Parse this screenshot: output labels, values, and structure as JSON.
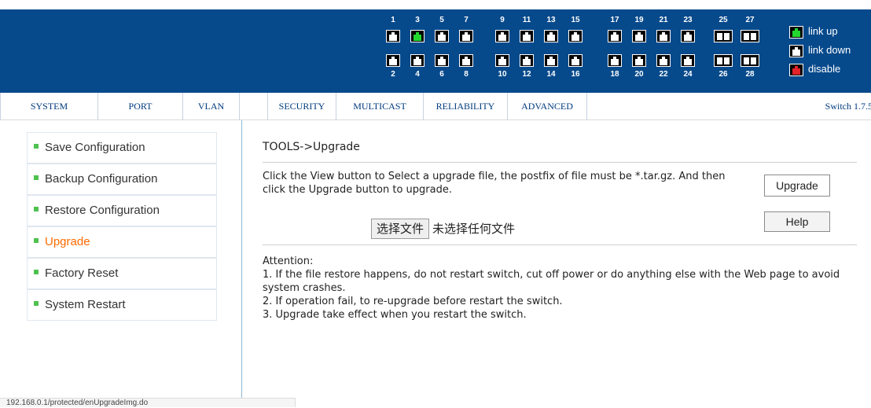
{
  "legend": {
    "link_up": "link up",
    "link_down": "link down",
    "disable": "disable",
    "colors": {
      "link_up": "#23d630",
      "link_down": "#ffffff",
      "disable": "#e2232a"
    }
  },
  "ports": {
    "top_numbers": [
      "1",
      "3",
      "5",
      "7",
      "9",
      "11",
      "13",
      "15",
      "17",
      "19",
      "21",
      "23",
      "25",
      "27"
    ],
    "bottom_numbers": [
      "2",
      "4",
      "6",
      "8",
      "10",
      "12",
      "14",
      "16",
      "18",
      "20",
      "22",
      "24",
      "26",
      "28"
    ],
    "link_up_ports": [
      "3"
    ]
  },
  "menu": {
    "tabs": [
      "SYSTEM",
      "PORT",
      "VLAN",
      "SECURITY",
      "MULTICAST",
      "RELIABILITY",
      "ADVANCED"
    ],
    "version": "Switch 1.7.5"
  },
  "sidebar": {
    "items": [
      {
        "label": "Save Configuration"
      },
      {
        "label": "Backup Configuration"
      },
      {
        "label": "Restore Configuration"
      },
      {
        "label": "Upgrade"
      },
      {
        "label": "Factory Reset"
      },
      {
        "label": "System Restart"
      }
    ],
    "active": "Upgrade",
    "active_color": "#ff6a00"
  },
  "main": {
    "breadcrumb": "TOOLS->Upgrade",
    "instruction": "Click the View button to Select a upgrade file, the postfix of file must be *.tar.gz. And then click the Upgrade button to upgrade.",
    "upgrade_button": "Upgrade",
    "help_button": "Help",
    "file_button": "选择文件",
    "file_status": "未选择任何文件",
    "attention_title": "Attention:",
    "attention_lines": [
      "1. If the file restore happens, do not restart switch, cut off power or do anything else with the Web page to avoid system crashes.",
      "2. If operation fail, to re-upgrade before restart the switch.",
      "3. Upgrade take effect when you restart the switch."
    ]
  },
  "status_bar": {
    "url": "192.168.0.1/protected/enUpgradeImg.do"
  }
}
